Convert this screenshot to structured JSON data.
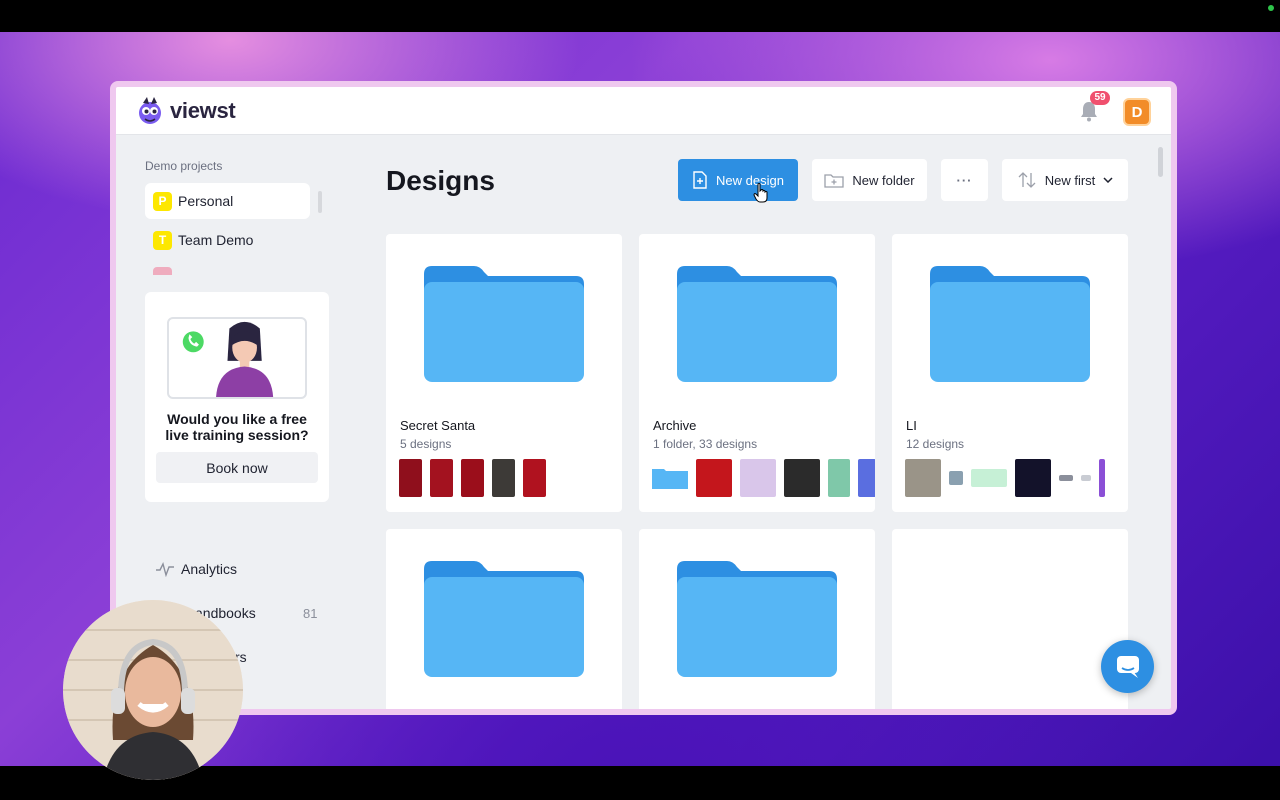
{
  "app": {
    "name": "viewst",
    "notifications_count": "59",
    "user_initial": "D"
  },
  "sidebar": {
    "section_title": "Demo projects",
    "projects": [
      {
        "initial": "P",
        "label": "Personal",
        "active": true
      },
      {
        "initial": "T",
        "label": "Team Demo",
        "active": false
      }
    ],
    "promo": {
      "text": "Would you like a free live training session?",
      "button": "Book now"
    },
    "nav": [
      {
        "label": "Analytics",
        "icon": "analytics-icon",
        "count": ""
      },
      {
        "label": "Brandbooks",
        "icon": "brandbook-icon",
        "count": "81"
      },
      {
        "label": "rs",
        "icon": "",
        "count": ""
      }
    ]
  },
  "main": {
    "title": "Designs",
    "toolbar": {
      "new_design": "New design",
      "new_folder": "New folder",
      "more": "···",
      "sort": "New first"
    },
    "folders": [
      {
        "name": "Secret Santa",
        "meta": "5 designs"
      },
      {
        "name": "Archive",
        "meta": "1 folder, 33 designs"
      },
      {
        "name": "LI",
        "meta": "12 designs"
      },
      {
        "name": "",
        "meta": ""
      },
      {
        "name": "",
        "meta": ""
      }
    ]
  },
  "colors": {
    "accent": "#2d8fe2",
    "folder": "#56b6f5",
    "folder_tab": "#2d8fe2",
    "badge": "#f0506e",
    "avatar": "#f28c28",
    "project_badge": "#fde700"
  }
}
